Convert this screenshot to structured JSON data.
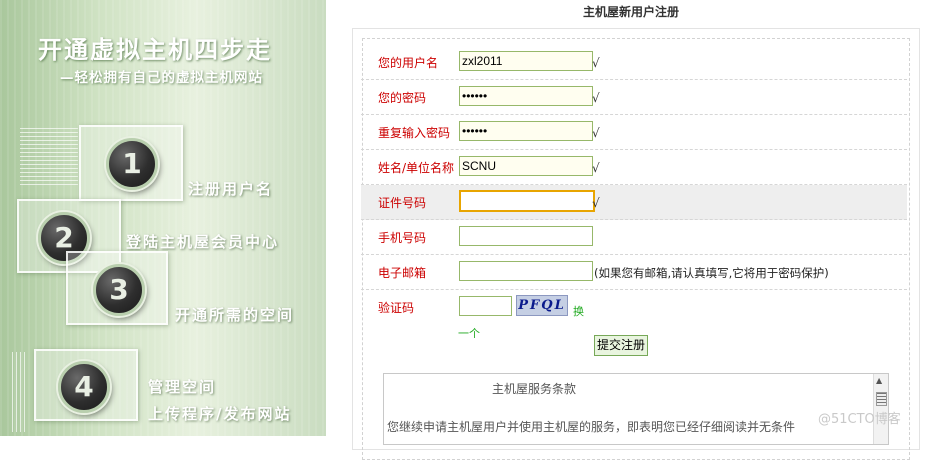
{
  "banner": {
    "title": "开通虚拟主机四步走",
    "subtitle": "—轻松拥有自己的虚拟主机网站",
    "steps": [
      {
        "number": "1",
        "label": "注册用户名"
      },
      {
        "number": "2",
        "label": "登陆主机屋会员中心"
      },
      {
        "number": "3",
        "label": "开通所需的空间"
      },
      {
        "number": "4",
        "label_line1": "管理空间",
        "label_line2": "上传程序/发布网站"
      }
    ]
  },
  "page": {
    "title": "主机屋新用户注册"
  },
  "form": {
    "username": {
      "label": "您的用户名",
      "value": "zxl2011",
      "check": "√"
    },
    "password": {
      "label": "您的密码",
      "value": "••••••",
      "check": "√"
    },
    "password_confirm": {
      "label": "重复输入密码",
      "value": "••••••",
      "check": "√"
    },
    "name": {
      "label": "姓名/单位名称",
      "value": "SCNU",
      "check": "√"
    },
    "id_number": {
      "label": "证件号码",
      "value": "",
      "check": "√"
    },
    "phone": {
      "label": "手机号码",
      "value": ""
    },
    "email": {
      "label": "电子邮箱",
      "value": "",
      "hint": "(如果您有邮箱,请认真填写,它将用于密码保护)"
    },
    "captcha": {
      "label": "验证码",
      "value": "",
      "image_text": "PFQL",
      "refresh": "换",
      "hint": "一个"
    },
    "submit_label": "提交注册"
  },
  "terms": {
    "title": "主机屋服务条款",
    "body": "您继续申请主机屋用户并使用主机屋的服务，即表明您已经仔细阅读并无条件"
  },
  "watermark": "@51CTO博客",
  "colors": {
    "label_red": "#cc0000",
    "field_border": "#97b86a",
    "focus_border": "#e8a500",
    "captcha_refresh": "#22aa22"
  }
}
